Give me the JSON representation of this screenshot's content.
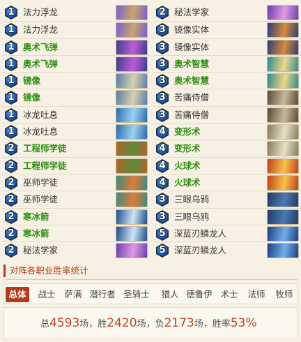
{
  "deck": {
    "left": [
      {
        "cost": "1",
        "name": "法力浮龙",
        "type": "common",
        "art": "mana-wyrm-art",
        "colors": [
          "#7b5fd1",
          "#c9a56a"
        ]
      },
      {
        "cost": "1",
        "name": "法力浮龙",
        "type": "common",
        "art": "mana-wyrm-art",
        "colors": [
          "#7b5fd1",
          "#c9a56a"
        ]
      },
      {
        "cost": "1",
        "name": "奥术飞弹",
        "type": "class",
        "art": "arcane-missiles-art",
        "colors": [
          "#3b3f8c",
          "#c05ad8"
        ]
      },
      {
        "cost": "1",
        "name": "奥术飞弹",
        "type": "class",
        "art": "arcane-missiles-art",
        "colors": [
          "#3b3f8c",
          "#c05ad8"
        ]
      },
      {
        "cost": "1",
        "name": "镜像",
        "type": "class",
        "art": "mirror-image-art",
        "colors": [
          "#5a7fa8",
          "#d8d0b0"
        ]
      },
      {
        "cost": "1",
        "name": "镜像",
        "type": "class",
        "art": "mirror-image-art",
        "colors": [
          "#5a7fa8",
          "#d8d0b0"
        ]
      },
      {
        "cost": "1",
        "name": "冰龙吐息",
        "type": "common",
        "art": "frost-breath-art",
        "colors": [
          "#2b6fb3",
          "#9ad2ef"
        ]
      },
      {
        "cost": "1",
        "name": "冰龙吐息",
        "type": "common",
        "art": "frost-breath-art",
        "colors": [
          "#2b6fb3",
          "#9ad2ef"
        ]
      },
      {
        "cost": "2",
        "name": "工程师学徒",
        "type": "class",
        "art": "engineer-apprentice-art",
        "colors": [
          "#b0652c",
          "#5c8a3a"
        ]
      },
      {
        "cost": "2",
        "name": "工程师学徒",
        "type": "class",
        "art": "engineer-apprentice-art",
        "colors": [
          "#b0652c",
          "#5c8a3a"
        ]
      },
      {
        "cost": "2",
        "name": "巫师学徒",
        "type": "common",
        "art": "sorcerer-apprentice-art",
        "colors": [
          "#3c8c7a",
          "#e07a3a"
        ]
      },
      {
        "cost": "2",
        "name": "巫师学徒",
        "type": "common",
        "art": "sorcerer-apprentice-art",
        "colors": [
          "#3c8c7a",
          "#e07a3a"
        ]
      },
      {
        "cost": "2",
        "name": "寒冰箭",
        "type": "class",
        "art": "frostbolt-art",
        "colors": [
          "#1f4e8a",
          "#cfe6f4"
        ]
      },
      {
        "cost": "2",
        "name": "寒冰箭",
        "type": "class",
        "art": "frostbolt-art",
        "colors": [
          "#1f4e8a",
          "#cfe6f4"
        ]
      },
      {
        "cost": "2",
        "name": "秘法学家",
        "type": "common",
        "art": "arcanologist-art",
        "colors": [
          "#6b3fb0",
          "#e09ae0"
        ]
      }
    ],
    "right": [
      {
        "cost": "2",
        "name": "秘法学家",
        "type": "common",
        "art": "arcanologist-art",
        "colors": [
          "#6b3fb0",
          "#e09ae0"
        ]
      },
      {
        "cost": "3",
        "name": "镜像实体",
        "type": "common",
        "art": "mirror-entity-art",
        "colors": [
          "#2a3f7a",
          "#d88a3a"
        ]
      },
      {
        "cost": "3",
        "name": "镜像实体",
        "type": "common",
        "art": "mirror-entity-art",
        "colors": [
          "#2a3f7a",
          "#d88a3a"
        ]
      },
      {
        "cost": "3",
        "name": "奥术智慧",
        "type": "class",
        "art": "arcane-intellect-art",
        "colors": [
          "#2c8c8c",
          "#f0d68a"
        ]
      },
      {
        "cost": "3",
        "name": "奥术智慧",
        "type": "class",
        "art": "arcane-intellect-art",
        "colors": [
          "#2c8c8c",
          "#f0d68a"
        ]
      },
      {
        "cost": "3",
        "name": "苦痛侍僧",
        "type": "common",
        "art": "acolyte-of-pain-art",
        "colors": [
          "#5a4a3a",
          "#c8b89a"
        ]
      },
      {
        "cost": "3",
        "name": "苦痛侍僧",
        "type": "common",
        "art": "acolyte-of-pain-art",
        "colors": [
          "#5a4a3a",
          "#c8b89a"
        ]
      },
      {
        "cost": "4",
        "name": "变形术",
        "type": "class",
        "art": "polymorph-art",
        "colors": [
          "#8a7a5a",
          "#e8e0c8"
        ]
      },
      {
        "cost": "4",
        "name": "变形术",
        "type": "class",
        "art": "polymorph-art",
        "colors": [
          "#8a7a5a",
          "#e8e0c8"
        ]
      },
      {
        "cost": "4",
        "name": "火球术",
        "type": "class",
        "art": "fireball-art",
        "colors": [
          "#c0401a",
          "#f6c24a"
        ]
      },
      {
        "cost": "4",
        "name": "火球术",
        "type": "class",
        "art": "fireball-art",
        "colors": [
          "#c0401a",
          "#f6c24a"
        ]
      },
      {
        "cost": "3",
        "name": "三眼乌鸦",
        "type": "common",
        "art": "three-eyed-raven-art",
        "colors": [
          "#233a6a",
          "#4a7ab0"
        ]
      },
      {
        "cost": "3",
        "name": "三眼乌鸦",
        "type": "common",
        "art": "three-eyed-raven-art",
        "colors": [
          "#233a6a",
          "#4a7ab0"
        ]
      },
      {
        "cost": "5",
        "name": "深蓝刃鳞龙人",
        "type": "common",
        "art": "azure-drake-art",
        "colors": [
          "#1f3c8a",
          "#6fb0e8"
        ]
      },
      {
        "cost": "5",
        "name": "深蓝刃鳞龙人",
        "type": "common",
        "art": "azure-drake-art",
        "colors": [
          "#1f3c8a",
          "#6fb0e8"
        ]
      }
    ]
  },
  "stats": {
    "title": "对阵各职业胜率统计",
    "tabs": [
      "总体",
      "战士",
      "萨满",
      "潜行者",
      "圣骑士",
      "猎人",
      "德鲁伊",
      "术士",
      "法师",
      "牧师"
    ],
    "active_tab": "总体",
    "summary": {
      "total_label": "总",
      "total": "4593",
      "games_unit1": "场，胜",
      "wins": "2420",
      "games_unit2": "场，负",
      "losses": "2173",
      "games_unit3": "场，胜率",
      "winrate": "53%"
    }
  },
  "colors": {
    "accent": "#b83a1c",
    "class_card_text": "#2d8f10",
    "background": "#f6f1e4"
  }
}
